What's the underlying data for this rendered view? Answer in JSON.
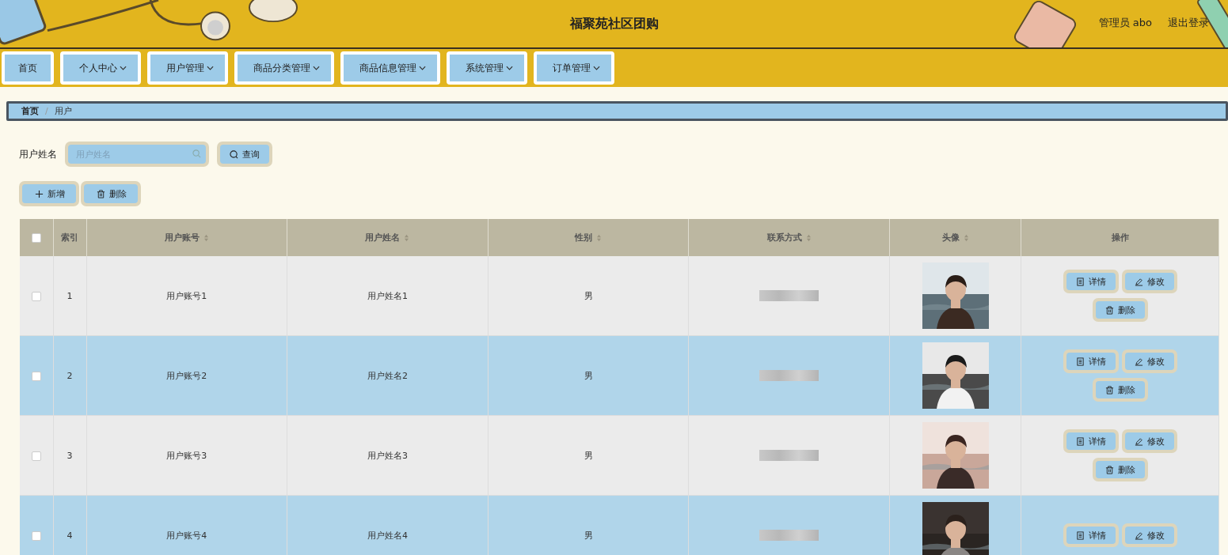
{
  "header": {
    "title": "福聚苑社区团购",
    "user": "管理员 abo",
    "logout": "退出登录"
  },
  "nav": [
    {
      "label": "首页",
      "dropdown": false
    },
    {
      "label": "个人中心",
      "dropdown": true
    },
    {
      "label": "用户管理",
      "dropdown": true
    },
    {
      "label": "商品分类管理",
      "dropdown": true
    },
    {
      "label": "商品信息管理",
      "dropdown": true
    },
    {
      "label": "系统管理",
      "dropdown": true
    },
    {
      "label": "订单管理",
      "dropdown": true
    }
  ],
  "breadcrumb": {
    "items": [
      "首页",
      "用户"
    ],
    "separator": "/"
  },
  "search": {
    "label": "用户姓名",
    "placeholder": "用户姓名",
    "button": "查询"
  },
  "toolbar": [
    {
      "kind": "add",
      "label": "新增"
    },
    {
      "kind": "delete",
      "label": "删除"
    }
  ],
  "table": {
    "select_all": {
      "checked": false
    },
    "columns": [
      {
        "label": "索引",
        "sortable": false
      },
      {
        "label": "用户账号",
        "sortable": true
      },
      {
        "label": "用户姓名",
        "sortable": true
      },
      {
        "label": "性别",
        "sortable": true
      },
      {
        "label": "联系方式",
        "sortable": true
      },
      {
        "label": "头像",
        "sortable": true
      },
      {
        "label": "操作",
        "sortable": false
      }
    ],
    "rows": [
      {
        "checked": false,
        "index": "1",
        "account": "用户账号1",
        "name": "用户姓名1",
        "gender": "男",
        "avatar": {
          "kind": "picture"
        },
        "actions": [
          {
            "kind": "detail",
            "label": "详情"
          },
          {
            "kind": "edit",
            "label": "修改"
          },
          {
            "kind": "delete",
            "label": "删除"
          }
        ]
      },
      {
        "checked": false,
        "index": "2",
        "account": "用户账号2",
        "name": "用户姓名2",
        "gender": "男",
        "avatar": {
          "kind": "picture"
        },
        "actions": [
          {
            "kind": "detail",
            "label": "详情"
          },
          {
            "kind": "edit",
            "label": "修改"
          },
          {
            "kind": "delete",
            "label": "删除"
          }
        ]
      },
      {
        "checked": false,
        "index": "3",
        "account": "用户账号3",
        "name": "用户姓名3",
        "gender": "男",
        "avatar": {
          "kind": "picture"
        },
        "actions": [
          {
            "kind": "detail",
            "label": "详情"
          },
          {
            "kind": "edit",
            "label": "修改"
          },
          {
            "kind": "delete",
            "label": "删除"
          }
        ]
      },
      {
        "checked": false,
        "index": "4",
        "account": "用户账号4",
        "name": "用户姓名4",
        "gender": "男",
        "avatar": {
          "kind": "picture"
        },
        "actions": [
          {
            "kind": "detail",
            "label": "详情"
          },
          {
            "kind": "edit",
            "label": "修改"
          }
        ]
      }
    ]
  }
}
